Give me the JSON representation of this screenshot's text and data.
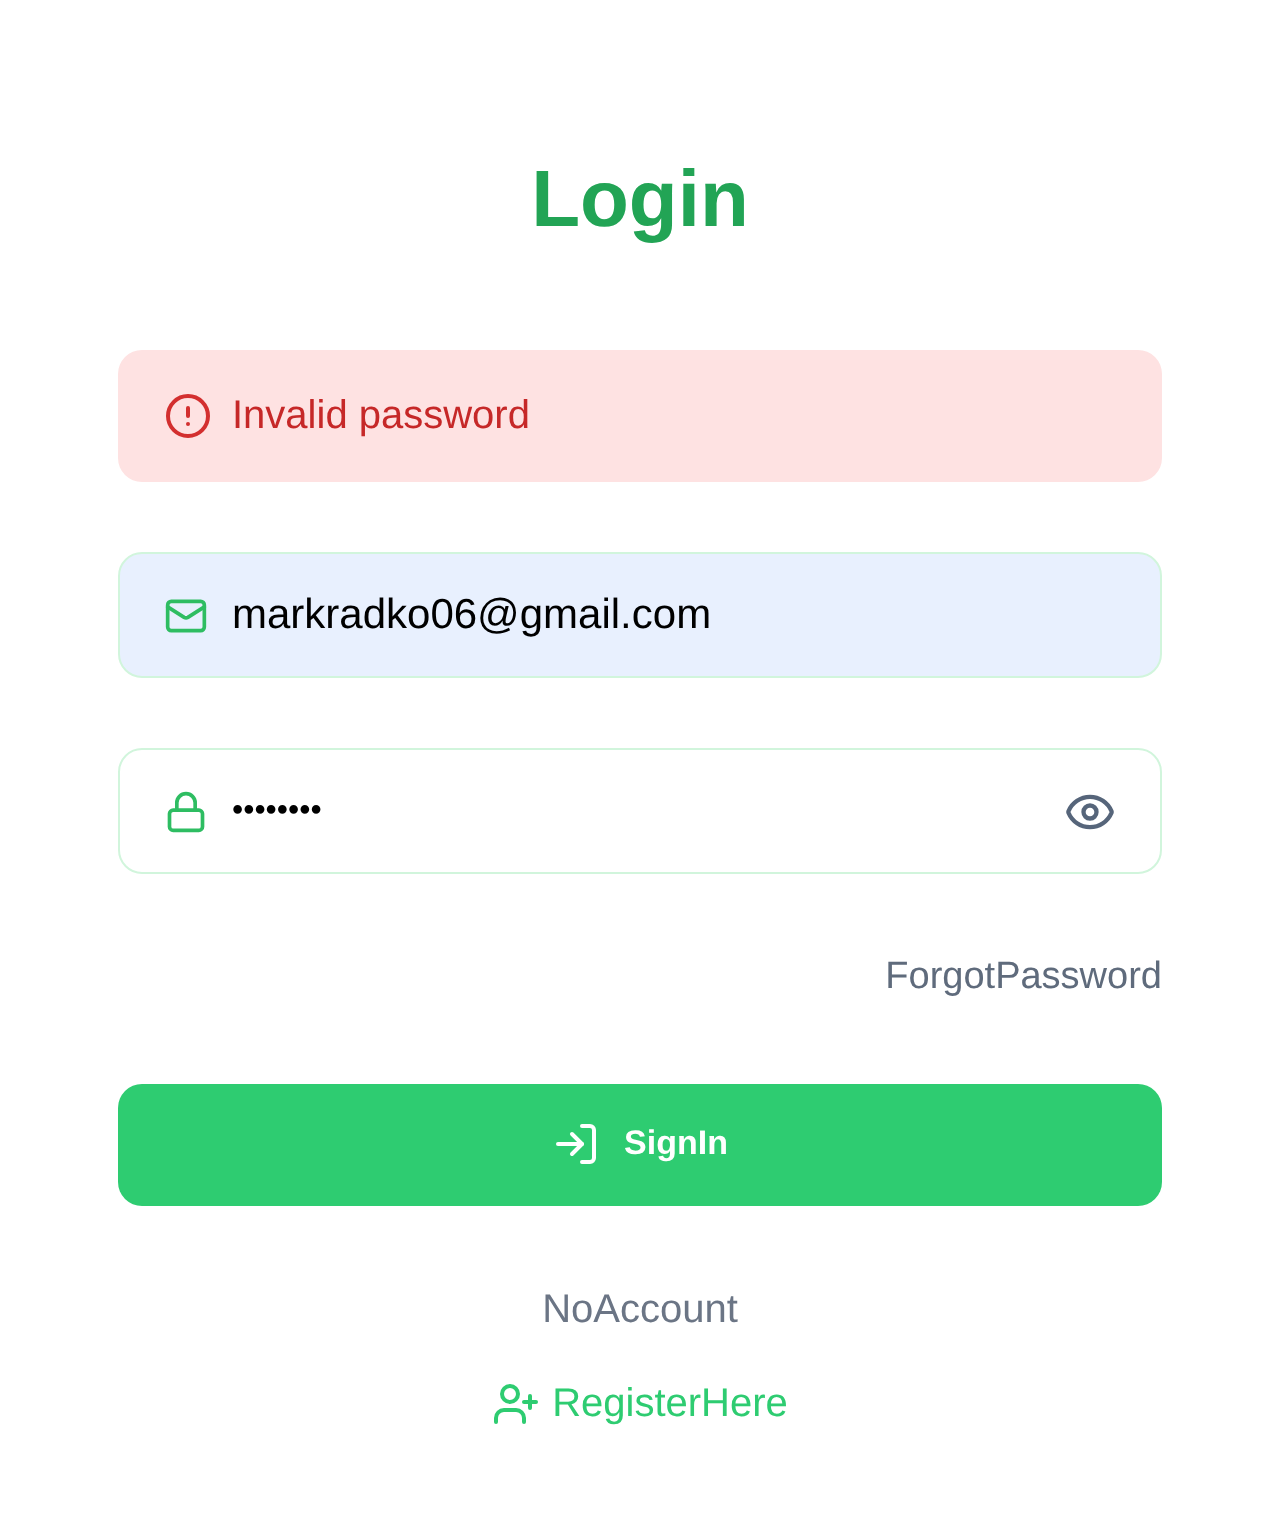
{
  "title": "Login",
  "error": {
    "message": "Invalid password"
  },
  "email": {
    "value": "markradko06@gmail.com"
  },
  "password": {
    "value": "••••••••"
  },
  "forgot_link": "ForgotPassword",
  "submit_button": "SignIn",
  "no_account": "NoAccount",
  "register_link": "RegisterHere"
}
